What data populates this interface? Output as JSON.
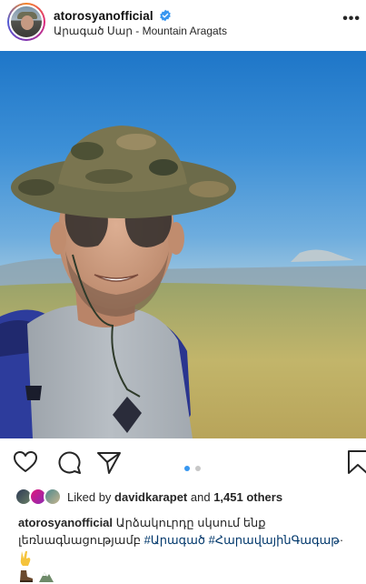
{
  "post": {
    "username": "atorosyanofficial",
    "location": "Արագած Սար - Mountain Aragats",
    "more_label": "•••"
  },
  "likes": {
    "prefix": "Liked by",
    "user": "davidkarapet",
    "conjunction": "and",
    "count": "1,451 others"
  },
  "caption": {
    "username": "atorosyanofficial",
    "text": "Արձակուրդը սկսում ենք լեռնագնացությամբ",
    "hashtag1": "#Արագած",
    "hashtag2": "#ՀարավայինԳագաթ",
    "suffix": "·"
  },
  "carousel": {
    "total": 2,
    "active": 1,
    "active_color": "#3897f0",
    "inactive_color": "#c7c7c7"
  },
  "icons": [
    "verified-badge-icon",
    "heart-icon",
    "comment-icon",
    "share-icon",
    "bookmark-icon",
    "victory-hand-emoji",
    "hiking-boot-emoji",
    "mountain-emoji"
  ]
}
